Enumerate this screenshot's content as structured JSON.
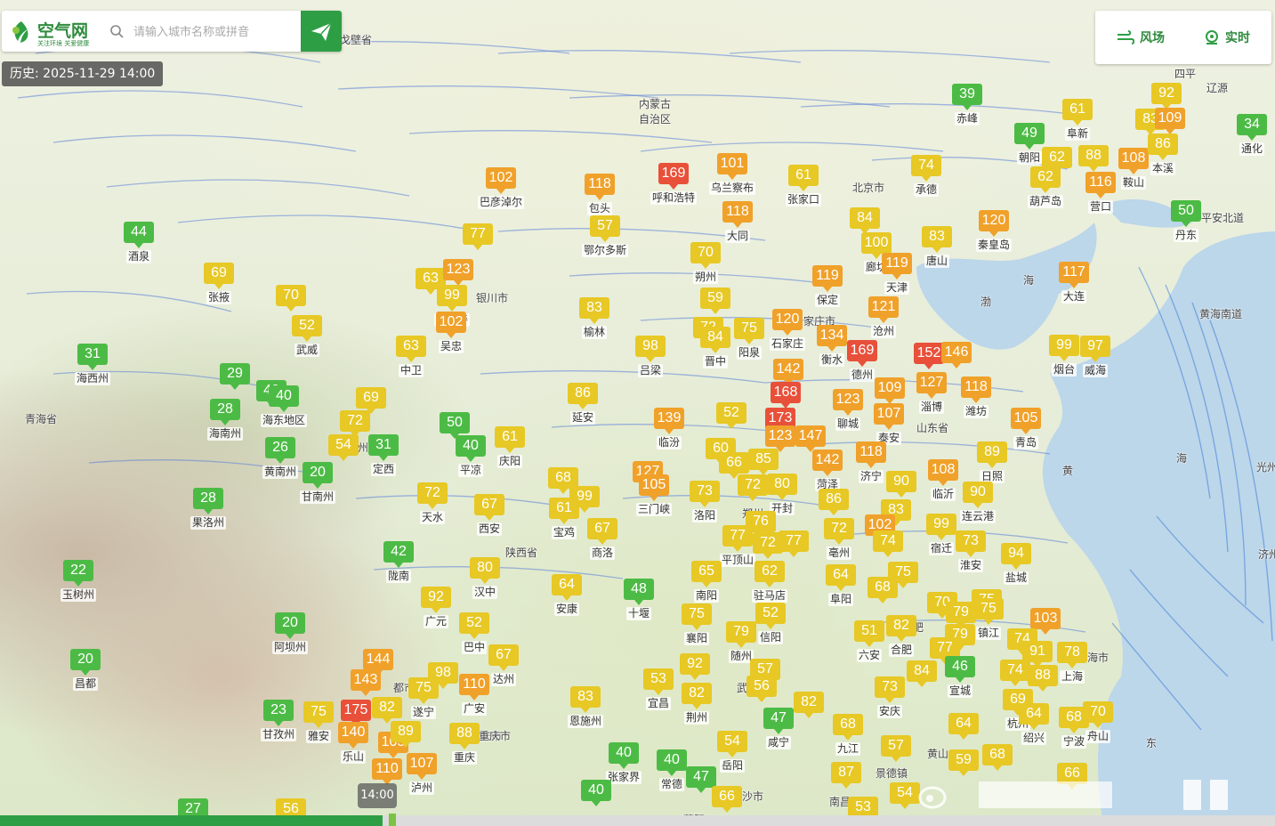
{
  "app": {
    "name": "空气网",
    "slogan": "关注环境 关爱健康"
  },
  "search": {
    "placeholder": "请输入城市名称或拼音"
  },
  "history": {
    "text": "历史: 2025-11-29 14:00"
  },
  "controls": {
    "wind_label": "风场",
    "realtime_label": "实时"
  },
  "timeline": {
    "time": "14:00",
    "progress": 0.3
  },
  "colors": {
    "good": "#4cbb45",
    "moderate": "#e7c825",
    "unhealthy_sensitive": "#f0a12a",
    "unhealthy": "#e8503a",
    "brand": "#2e9e44"
  },
  "regions": [
    {
      "name": "内蒙古\n自治区"
    },
    {
      "name": "青海省"
    },
    {
      "name": "陕西省"
    },
    {
      "name": "南戈壁省"
    },
    {
      "name": "渤"
    },
    {
      "name": "海"
    },
    {
      "name": "黄"
    },
    {
      "name": "海"
    },
    {
      "name": "东"
    }
  ],
  "stations": [
    {
      "v": 102,
      "name": "巴彦淖尔"
    },
    {
      "v": 118,
      "name": "包头"
    },
    {
      "v": 169,
      "name": "呼和浩特"
    },
    {
      "v": 101,
      "name": "乌兰察布"
    },
    {
      "v": 61,
      "name": "张家口"
    },
    {
      "v": 39,
      "name": "赤峰"
    },
    {
      "v": 61,
      "name": "阜新"
    },
    {
      "v": 92,
      "name": ""
    },
    {
      "v": 49,
      "name": "朝阳"
    },
    {
      "v": 62,
      "name": ""
    },
    {
      "v": 88,
      "name": ""
    },
    {
      "v": 108,
      "name": "鞍山"
    },
    {
      "v": 83,
      "name": ""
    },
    {
      "v": 109,
      "name": ""
    },
    {
      "v": 86,
      "name": "本溪"
    },
    {
      "v": 34,
      "name": "通化"
    },
    {
      "v": 62,
      "name": "葫芦岛"
    },
    {
      "v": 116,
      "name": "营口"
    },
    {
      "v": 74,
      "name": "承德"
    },
    {
      "v": 50,
      "name": "丹东"
    },
    {
      "v": 44,
      "name": "酒泉"
    },
    {
      "v": 69,
      "name": "张掖"
    },
    {
      "v": 70,
      "name": ""
    },
    {
      "v": 52,
      "name": "武威"
    },
    {
      "v": 77,
      "name": ""
    },
    {
      "v": 57,
      "name": "鄂尔多斯"
    },
    {
      "v": 118,
      "name": "大同"
    },
    {
      "v": 84,
      "name": ""
    },
    {
      "v": 100,
      "name": "廊坊"
    },
    {
      "v": 83,
      "name": "唐山"
    },
    {
      "v": 120,
      "name": "秦皇岛"
    },
    {
      "v": 117,
      "name": "大连"
    },
    {
      "v": 63,
      "name": ""
    },
    {
      "v": 123,
      "name": ""
    },
    {
      "v": 99,
      "name": "阿拉善"
    },
    {
      "v": 102,
      "name": "吴忠"
    },
    {
      "v": 70,
      "name": "朔州"
    },
    {
      "v": 119,
      "name": "保定"
    },
    {
      "v": 119,
      "name": "天津"
    },
    {
      "v": 59,
      "name": ""
    },
    {
      "v": 121,
      "name": "沧州"
    },
    {
      "v": 31,
      "name": "海西州"
    },
    {
      "v": 63,
      "name": "中卫"
    },
    {
      "v": 83,
      "name": "榆林"
    },
    {
      "v": 98,
      "name": "吕梁"
    },
    {
      "v": 72,
      "name": ""
    },
    {
      "v": 84,
      "name": "晋中"
    },
    {
      "v": 75,
      "name": "阳泉"
    },
    {
      "v": 120,
      "name": "石家庄"
    },
    {
      "v": 134,
      "name": "衡水"
    },
    {
      "v": 169,
      "name": "德州"
    },
    {
      "v": 152,
      "name": ""
    },
    {
      "v": 146,
      "name": ""
    },
    {
      "v": 99,
      "name": "烟台"
    },
    {
      "v": 97,
      "name": "威海"
    },
    {
      "v": 29,
      "name": ""
    },
    {
      "v": 42,
      "name": ""
    },
    {
      "v": 40,
      "name": "海东地区"
    },
    {
      "v": 28,
      "name": "海南州"
    },
    {
      "v": 69,
      "name": ""
    },
    {
      "v": 86,
      "name": "延安"
    },
    {
      "v": 142,
      "name": ""
    },
    {
      "v": 168,
      "name": ""
    },
    {
      "v": 109,
      "name": ""
    },
    {
      "v": 127,
      "name": "淄博"
    },
    {
      "v": 118,
      "name": "潍坊"
    },
    {
      "v": 72,
      "name": ""
    },
    {
      "v": 50,
      "name": ""
    },
    {
      "v": 139,
      "name": "临汾"
    },
    {
      "v": 52,
      "name": ""
    },
    {
      "v": 173,
      "name": ""
    },
    {
      "v": 123,
      "name": "聊城"
    },
    {
      "v": 107,
      "name": "泰安"
    },
    {
      "v": 105,
      "name": "青岛"
    },
    {
      "v": 26,
      "name": "黄南州"
    },
    {
      "v": 54,
      "name": ""
    },
    {
      "v": 31,
      "name": "定西"
    },
    {
      "v": 40,
      "name": "平凉"
    },
    {
      "v": 61,
      "name": "庆阳"
    },
    {
      "v": 123,
      "name": ""
    },
    {
      "v": 147,
      "name": ""
    },
    {
      "v": 60,
      "name": ""
    },
    {
      "v": 66,
      "name": ""
    },
    {
      "v": 85,
      "name": ""
    },
    {
      "v": 142,
      "name": "菏泽"
    },
    {
      "v": 118,
      "name": "济宁"
    },
    {
      "v": 108,
      "name": "临沂"
    },
    {
      "v": 89,
      "name": "日照"
    },
    {
      "v": 20,
      "name": "甘南州"
    },
    {
      "v": 28,
      "name": "果洛州"
    },
    {
      "v": 68,
      "name": ""
    },
    {
      "v": 127,
      "name": ""
    },
    {
      "v": 105,
      "name": "三门峡"
    },
    {
      "v": 72,
      "name": "天水"
    },
    {
      "v": 99,
      "name": ""
    },
    {
      "v": 67,
      "name": "西安"
    },
    {
      "v": 61,
      "name": "宝鸡"
    },
    {
      "v": 73,
      "name": "洛阳"
    },
    {
      "v": 72,
      "name": ""
    },
    {
      "v": 80,
      "name": "开封"
    },
    {
      "v": 90,
      "name": ""
    },
    {
      "v": 90,
      "name": "连云港"
    },
    {
      "v": 67,
      "name": "商洛"
    },
    {
      "v": 86,
      "name": ""
    },
    {
      "v": 83,
      "name": ""
    },
    {
      "v": 76,
      "name": ""
    },
    {
      "v": 102,
      "name": ""
    },
    {
      "v": 72,
      "name": "亳州"
    },
    {
      "v": 99,
      "name": "宿迁"
    },
    {
      "v": 22,
      "name": "玉树州"
    },
    {
      "v": 42,
      "name": "陇南"
    },
    {
      "v": 77,
      "name": "平顶山"
    },
    {
      "v": 72,
      "name": ""
    },
    {
      "v": 77,
      "name": ""
    },
    {
      "v": 74,
      "name": ""
    },
    {
      "v": 73,
      "name": "淮安"
    },
    {
      "v": 80,
      "name": "汉中"
    },
    {
      "v": 65,
      "name": "南阳"
    },
    {
      "v": 62,
      "name": "驻马店"
    },
    {
      "v": 64,
      "name": "阜阳"
    },
    {
      "v": 75,
      "name": ""
    },
    {
      "v": 94,
      "name": "盐城"
    },
    {
      "v": 92,
      "name": "广元"
    },
    {
      "v": 64,
      "name": "安康"
    },
    {
      "v": 48,
      "name": "十堰"
    },
    {
      "v": 68,
      "name": ""
    },
    {
      "v": 20,
      "name": "阿坝州"
    },
    {
      "v": 52,
      "name": "巴中"
    },
    {
      "v": 75,
      "name": "襄阳"
    },
    {
      "v": 52,
      "name": "信阳"
    },
    {
      "v": 70,
      "name": ""
    },
    {
      "v": 75,
      "name": ""
    },
    {
      "v": 79,
      "name": ""
    },
    {
      "v": 75,
      "name": "镇江"
    },
    {
      "v": 79,
      "name": ""
    },
    {
      "v": 103,
      "name": ""
    },
    {
      "v": 67,
      "name": "达州"
    },
    {
      "v": 79,
      "name": "随州"
    },
    {
      "v": 51,
      "name": "六安"
    },
    {
      "v": 82,
      "name": "合肥"
    },
    {
      "v": 77,
      "name": ""
    },
    {
      "v": 74,
      "name": ""
    },
    {
      "v": 91,
      "name": ""
    },
    {
      "v": 20,
      "name": "昌都"
    },
    {
      "v": 144,
      "name": ""
    },
    {
      "v": 98,
      "name": ""
    },
    {
      "v": 92,
      "name": ""
    },
    {
      "v": 78,
      "name": "上海"
    },
    {
      "v": 143,
      "name": ""
    },
    {
      "v": 75,
      "name": "遂宁"
    },
    {
      "v": 110,
      "name": "广安"
    },
    {
      "v": 53,
      "name": "宜昌"
    },
    {
      "v": 57,
      "name": ""
    },
    {
      "v": 56,
      "name": ""
    },
    {
      "v": 46,
      "name": "宣城"
    },
    {
      "v": 74,
      "name": ""
    },
    {
      "v": 88,
      "name": ""
    },
    {
      "v": 82,
      "name": "荆州"
    },
    {
      "v": 82,
      "name": ""
    },
    {
      "v": 73,
      "name": "安庆"
    },
    {
      "v": 84,
      "name": ""
    },
    {
      "v": 23,
      "name": "甘孜州"
    },
    {
      "v": 75,
      "name": "雅安"
    },
    {
      "v": 175,
      "name": ""
    },
    {
      "v": 82,
      "name": ""
    },
    {
      "v": 83,
      "name": "恩施州"
    },
    {
      "v": 69,
      "name": "杭州"
    },
    {
      "v": 64,
      "name": "绍兴"
    },
    {
      "v": 68,
      "name": "宁波"
    },
    {
      "v": 70,
      "name": "舟山"
    },
    {
      "v": 140,
      "name": "乐山"
    },
    {
      "v": 105,
      "name": ""
    },
    {
      "v": 89,
      "name": ""
    },
    {
      "v": 88,
      "name": "重庆"
    },
    {
      "v": 47,
      "name": "咸宁"
    },
    {
      "v": 68,
      "name": "九江"
    },
    {
      "v": 57,
      "name": ""
    },
    {
      "v": 54,
      "name": "岳阳"
    },
    {
      "v": 64,
      "name": ""
    },
    {
      "v": 110,
      "name": ""
    },
    {
      "v": 107,
      "name": "泸州"
    },
    {
      "v": 40,
      "name": "张家界"
    },
    {
      "v": 40,
      "name": "常德"
    },
    {
      "v": 59,
      "name": ""
    },
    {
      "v": 68,
      "name": ""
    },
    {
      "v": 87,
      "name": ""
    },
    {
      "v": 66,
      "name": ""
    },
    {
      "v": 47,
      "name": ""
    },
    {
      "v": 40,
      "name": ""
    },
    {
      "v": 66,
      "name": ""
    },
    {
      "v": 54,
      "name": ""
    },
    {
      "v": 53,
      "name": ""
    },
    {
      "v": 27,
      "name": ""
    },
    {
      "v": 56,
      "name": ""
    }
  ],
  "map_labels": [
    {
      "text": "北京市"
    },
    {
      "text": "家庄市"
    },
    {
      "text": "银川市"
    },
    {
      "text": "兰州"
    },
    {
      "text": "郑州"
    },
    {
      "text": "武汉"
    },
    {
      "text": "肥"
    },
    {
      "text": "海市"
    },
    {
      "text": "沙市"
    },
    {
      "text": "都市"
    },
    {
      "text": "庆市"
    },
    {
      "text": "重庆市"
    },
    {
      "text": "辽源"
    },
    {
      "text": "四平"
    },
    {
      "text": "平安北道"
    },
    {
      "text": "黄海南道"
    },
    {
      "text": "光州"
    },
    {
      "text": "济州"
    },
    {
      "text": "山东省"
    },
    {
      "text": "景德镇"
    },
    {
      "text": "黄山"
    },
    {
      "text": "南昌"
    },
    {
      "text": "萍阳"
    }
  ]
}
